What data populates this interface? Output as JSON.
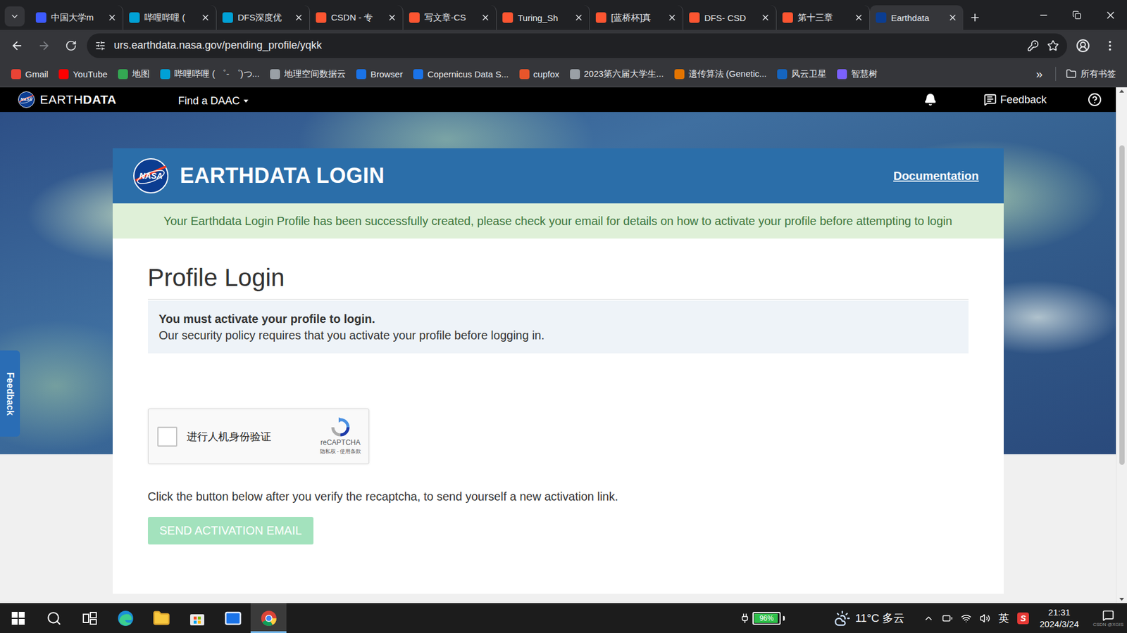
{
  "browser": {
    "tabs": [
      {
        "label": "中国大学m",
        "selected": false,
        "color": "#3d5afe"
      },
      {
        "label": "哔哩哔哩 (",
        "selected": false,
        "color": "#00a1d6"
      },
      {
        "label": "DFS深度优",
        "selected": false,
        "color": "#00a1d6"
      },
      {
        "label": "CSDN - 专",
        "selected": false,
        "color": "#fc5531"
      },
      {
        "label": "写文章-CS",
        "selected": false,
        "color": "#fc5531"
      },
      {
        "label": "Turing_Sh",
        "selected": false,
        "color": "#fc5531"
      },
      {
        "label": "[蓝桥杯]真",
        "selected": false,
        "color": "#fc5531"
      },
      {
        "label": "DFS- CSD",
        "selected": false,
        "color": "#fc5531"
      },
      {
        "label": "第十三章",
        "selected": false,
        "color": "#fc5531"
      },
      {
        "label": "Earthdata",
        "selected": true,
        "color": "#0b3d91"
      }
    ],
    "url": "urs.earthdata.nasa.gov/pending_profile/yqkk",
    "bookmarks": [
      {
        "label": "Gmail",
        "color": "#ea4335"
      },
      {
        "label": "YouTube",
        "color": "#ff0000"
      },
      {
        "label": "地图",
        "color": "#34a853"
      },
      {
        "label": "哔哩哔哩 ( ゜- ゜)つ...",
        "color": "#00a1d6"
      },
      {
        "label": "地理空间数据云",
        "color": "#9aa0a6"
      },
      {
        "label": "Browser",
        "color": "#1a73e8"
      },
      {
        "label": "Copernicus Data S...",
        "color": "#1a73e8"
      },
      {
        "label": "cupfox",
        "color": "#e8552b"
      },
      {
        "label": "2023第六届大学生...",
        "color": "#9aa0a6"
      },
      {
        "label": "遗传算法 (Genetic...",
        "color": "#e37400"
      },
      {
        "label": "风云卫星",
        "color": "#1565c0"
      },
      {
        "label": "智慧树",
        "color": "#7b61ff"
      }
    ],
    "more": "»",
    "all_bookmarks": "所有书签"
  },
  "site_nav": {
    "logo": "NASA",
    "logo_light": "EARTH",
    "logo_bold": "DATA",
    "menu": "Find a DAAC",
    "feedback": "Feedback"
  },
  "side_feedback": "Feedback",
  "card": {
    "title": "EARTHDATA LOGIN",
    "doc_link": "Documentation",
    "alert": "Your Earthdata Login Profile has been successfully created, please check your email for details on how to activate your profile before attempting to login",
    "heading": "Profile Login",
    "notice_title": "You must activate your profile to login.",
    "notice_text": "Our security policy requires that you activate your profile before logging in.",
    "captcha": {
      "label": "进行人机身份验证",
      "checked": false,
      "brand": "reCAPTCHA",
      "terms": "隐私权 - 使用条款"
    },
    "instruction": "Click the button below after you verify the recaptcha, to send yourself a new activation link.",
    "button": {
      "label": "SEND ACTIVATION EMAIL",
      "disabled": true
    }
  },
  "taskbar": {
    "apps": [
      {
        "selected": false
      },
      {
        "selected": false
      },
      {
        "selected": false
      },
      {
        "selected": false
      },
      {
        "selected": false
      },
      {
        "selected": false
      },
      {
        "selected": false
      },
      {
        "selected": true
      }
    ],
    "battery": {
      "reading": "96%",
      "level": 0.96
    },
    "weather": "11°C 多云",
    "ime": "英",
    "ime_logo": "S",
    "time": "21:31",
    "date": "2024/3/24",
    "watermark": "CSDN @XGIS"
  }
}
